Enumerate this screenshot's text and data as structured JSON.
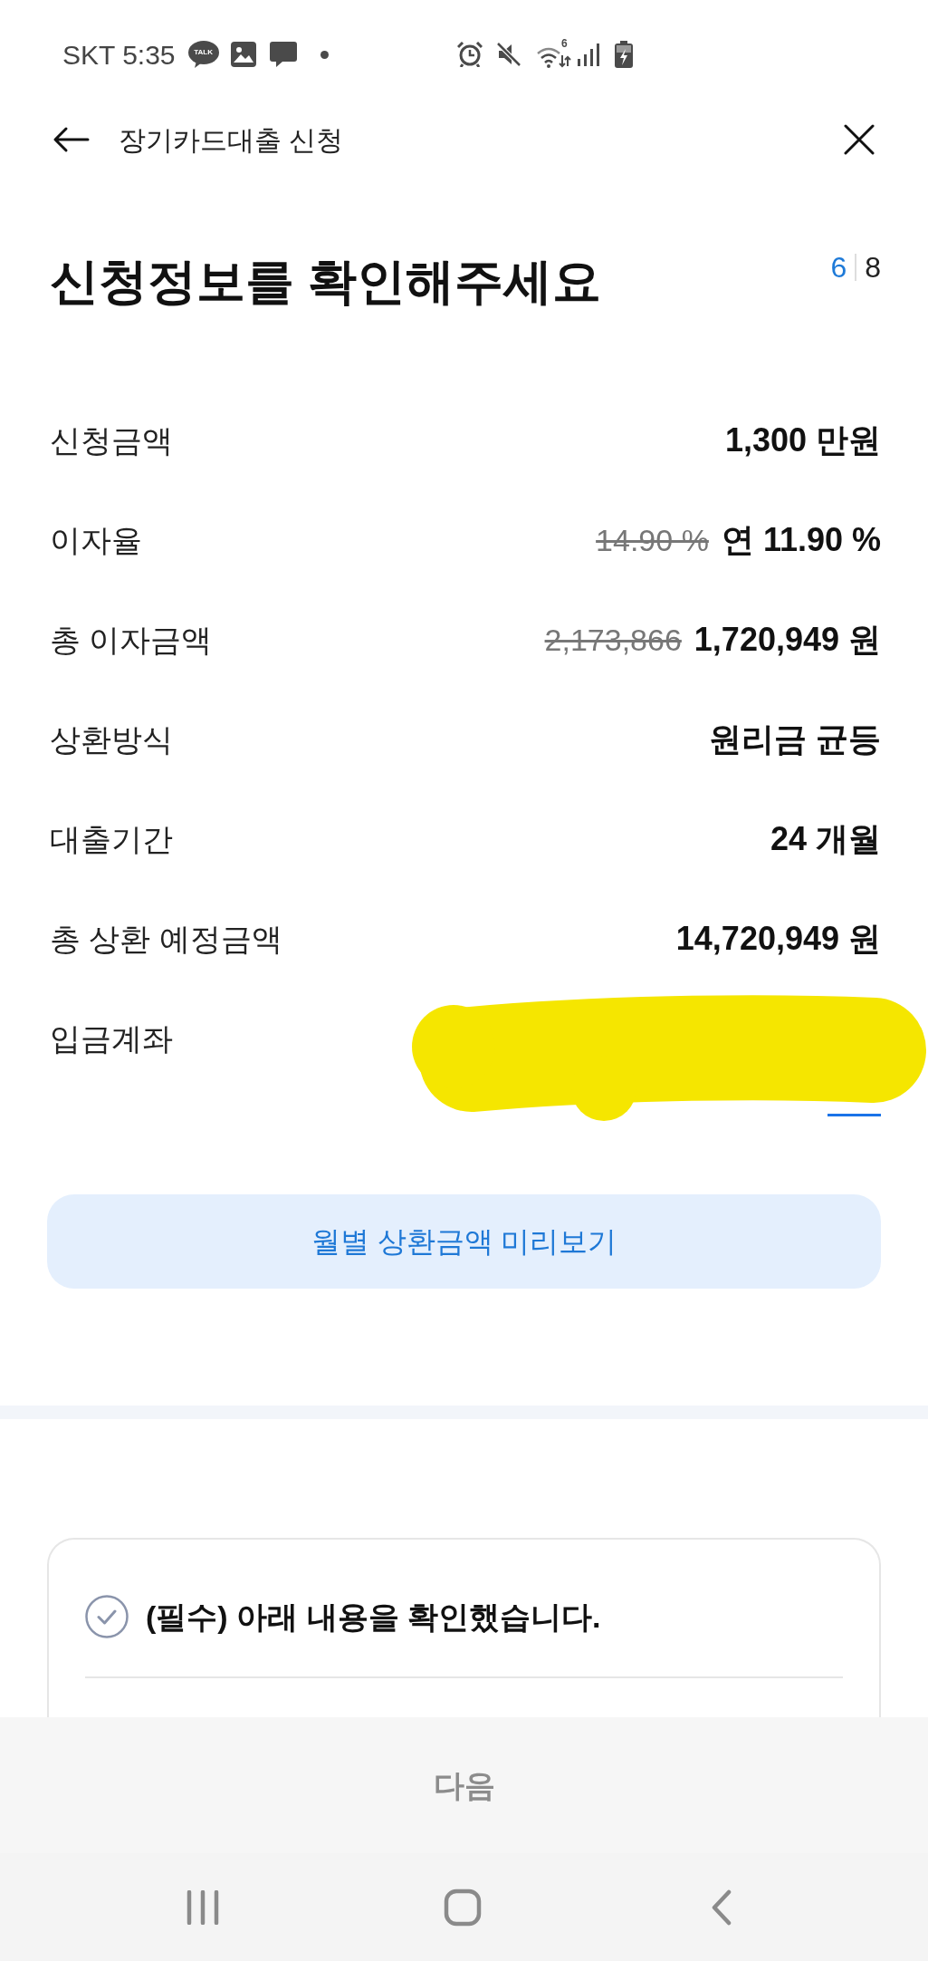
{
  "status_bar": {
    "carrier": "SKT",
    "time": "5:35",
    "talk_badge": "TALK",
    "wifi_label": "6"
  },
  "header": {
    "title": "장기카드대출 신청"
  },
  "page": {
    "title": "신청정보를 확인해주세요",
    "step": {
      "current": "6",
      "total": "8"
    }
  },
  "details": [
    {
      "label": "신청금액",
      "value": "1,300 만원"
    },
    {
      "label": "이자율",
      "original": "14.90 %",
      "value": "연 11.90 %"
    },
    {
      "label": "총 이자금액",
      "original": "2,173,866",
      "value": "1,720,949 원"
    },
    {
      "label": "상환방식",
      "value": "원리금 균등"
    },
    {
      "label": "대출기간",
      "value": "24 개월"
    },
    {
      "label": "총 상환 예정금액",
      "value": "14,720,949 원"
    },
    {
      "label": "입금계좌",
      "redacted": true
    }
  ],
  "preview_button": {
    "label": "월별 상환금액 미리보기"
  },
  "agreement": {
    "label": "(필수) 아래 내용을 확인했습니다.",
    "checked": false
  },
  "next_button": {
    "label": "다음",
    "disabled": true
  }
}
